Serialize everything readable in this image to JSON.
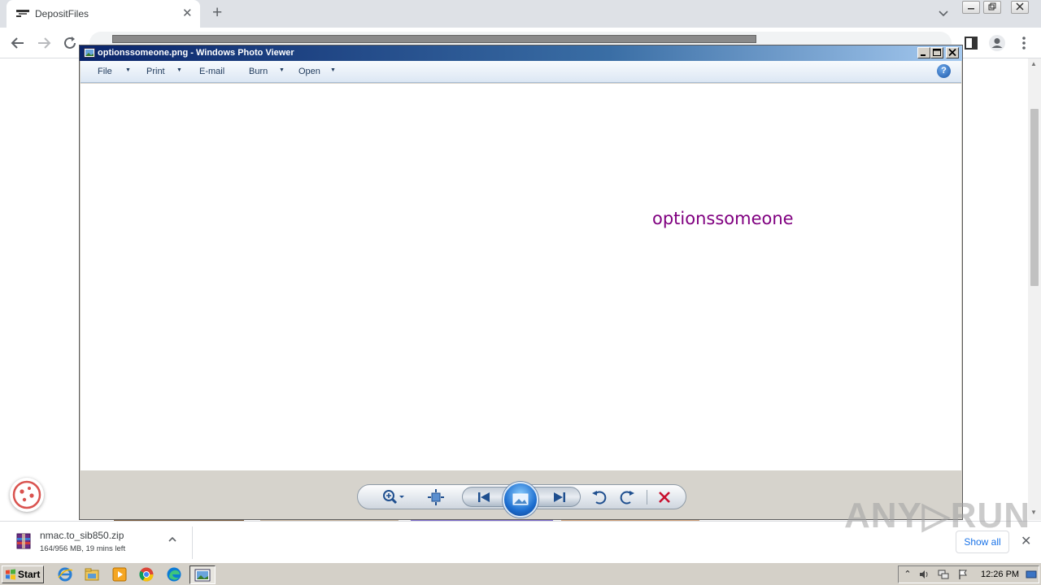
{
  "browser": {
    "tab": {
      "title": "DepositFiles",
      "favicon": "depositfiles-icon",
      "close": "✕"
    },
    "new_tab": "+",
    "window_controls": [
      "minimize",
      "restore",
      "close"
    ]
  },
  "photo_viewer": {
    "title": "optionssomeone.png - Windows Photo Viewer",
    "menu": [
      {
        "label": "File",
        "has_dropdown": true
      },
      {
        "label": "Print",
        "has_dropdown": true
      },
      {
        "label": "E-mail",
        "has_dropdown": false
      },
      {
        "label": "Burn",
        "has_dropdown": true
      },
      {
        "label": "Open",
        "has_dropdown": true
      }
    ],
    "help": "?",
    "image_text": "optionssomeone",
    "image_text_color": "#800080",
    "controls": [
      "zoom-icon",
      "actual-size-icon",
      "previous-icon",
      "slideshow-icon",
      "next-icon",
      "rotate-left-icon",
      "rotate-right-icon",
      "delete-icon"
    ]
  },
  "downloads": {
    "filename": "nmac.to_sib850.zip",
    "status": "164/956 MB, 19 mins left",
    "show_all": "Show all",
    "close": "✕"
  },
  "watermark": "ANY▷RUN",
  "taskbar": {
    "start": "Start",
    "clock": "12:26 PM"
  }
}
